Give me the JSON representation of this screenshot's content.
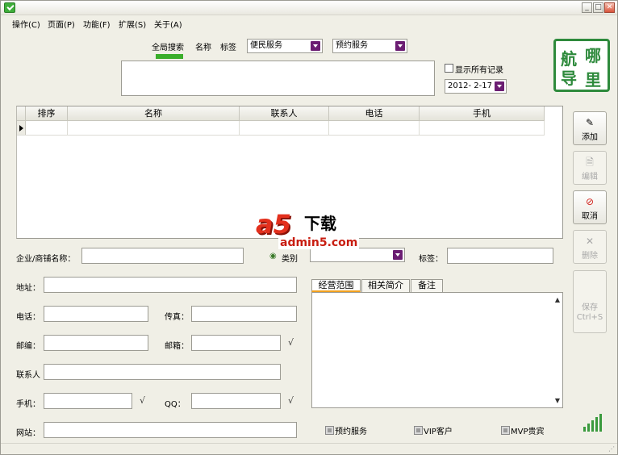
{
  "window": {
    "title": ""
  },
  "menu": [
    {
      "label": "操作(C)"
    },
    {
      "label": "页面(P)"
    },
    {
      "label": "功能(F)"
    },
    {
      "label": "扩展(S)"
    },
    {
      "label": "关于(A)"
    }
  ],
  "search_tabs": [
    {
      "label": "全局搜索",
      "active": true
    },
    {
      "label": "名称"
    },
    {
      "label": "标签"
    }
  ],
  "filters": {
    "category_combo": "便民服务",
    "service_combo": "预约服务",
    "show_all_label": "显示所有记录",
    "date_combo": "2012- 2-17"
  },
  "grid": {
    "columns": [
      "排序",
      "名称",
      "联系人",
      "电话",
      "手机"
    ],
    "rows": [
      [
        "",
        "",
        "",
        "",
        ""
      ]
    ]
  },
  "side_buttons": [
    {
      "label": "添加",
      "icon": "add-icon",
      "enabled": true
    },
    {
      "label": "编辑",
      "icon": "edit-icon",
      "enabled": false
    },
    {
      "label": "取消",
      "icon": "cancel-icon",
      "enabled": true
    },
    {
      "label": "删除",
      "icon": "delete-icon",
      "enabled": false
    },
    {
      "label": "保存 Ctrl+S",
      "icon": "save-icon",
      "enabled": false
    }
  ],
  "form": {
    "company_label": "企业/商铺名称：",
    "category_label": "类别",
    "tags_label": "标签：",
    "address_label": "地址：",
    "phone_label": "电话：",
    "fax_label": "传真：",
    "zip_label": "邮编：",
    "email_label": "邮箱：",
    "contact_label": "联系人",
    "mobile_label": "手机：",
    "qq_label": "QQ：",
    "website_label": "网站：",
    "check_mark": "√"
  },
  "detail_tabs": [
    {
      "label": "经营范围",
      "active": true
    },
    {
      "label": "相关简介"
    },
    {
      "label": "备注"
    }
  ],
  "bottom_checks": [
    {
      "label": "预约服务"
    },
    {
      "label": "VIP客户"
    },
    {
      "label": "MVP贵宾"
    }
  ],
  "logo": {
    "chars": [
      "导",
      "哪",
      "航",
      "里"
    ]
  },
  "watermark": {
    "brand": "a5",
    "text": "下载",
    "url": "admin5.com"
  },
  "colors": {
    "accent_green": "#3aae2a",
    "combo_purple": "#6b1d72",
    "tab_orange": "#f2a11e"
  }
}
